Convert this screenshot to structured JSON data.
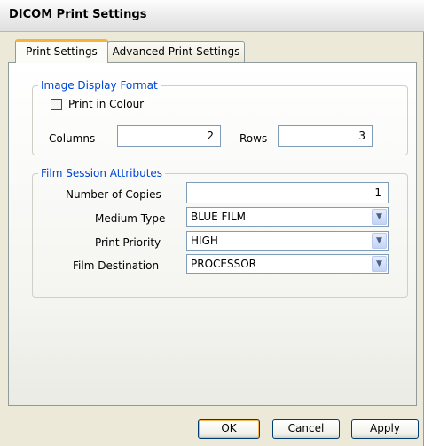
{
  "window": {
    "title": "DICOM Print Settings"
  },
  "tabs": [
    {
      "label": "Print Settings",
      "active": true
    },
    {
      "label": "Advanced Print Settings",
      "active": false
    }
  ],
  "image_display_format": {
    "legend": "Image Display Format",
    "print_in_colour": {
      "label": "Print in Colour",
      "checked": false
    },
    "columns": {
      "label": "Columns",
      "value": "2"
    },
    "rows": {
      "label": "Rows",
      "value": "3"
    }
  },
  "film_session": {
    "legend": "Film Session Attributes",
    "copies": {
      "label": "Number of Copies",
      "value": "1"
    },
    "medium_type": {
      "label": "Medium Type",
      "value": "BLUE FILM"
    },
    "print_priority": {
      "label": "Print Priority",
      "value": "HIGH"
    },
    "film_destination": {
      "label": "Film Destination",
      "value": "PROCESSOR"
    }
  },
  "buttons": {
    "ok": "OK",
    "cancel": "Cancel",
    "apply": "Apply"
  },
  "colors": {
    "accent_tab": "#f7b33d",
    "legend_text": "#0046d5",
    "button_border": "#003c74"
  }
}
